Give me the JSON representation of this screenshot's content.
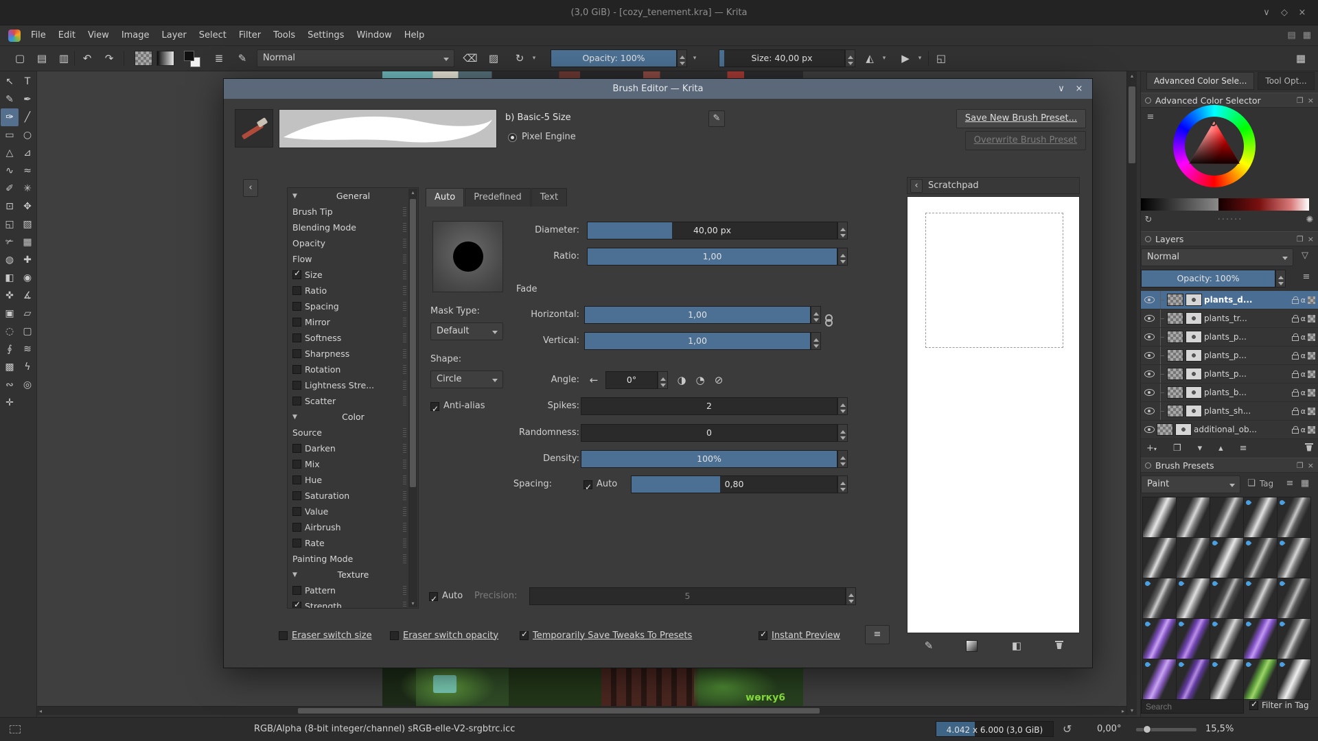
{
  "window": {
    "title": "(3,0 GiB) - [cozy_tenement.kra] — Krita"
  },
  "icons": {
    "shade": "∨",
    "restore": "◇",
    "close": "×",
    "new_doc": "▢",
    "open_doc": "▤",
    "save_doc": "▥",
    "undo": "↶",
    "redo": "↷",
    "choose_preset": "≣",
    "brush_editor": "✎",
    "eraser": "⌫",
    "preserve_alpha": "▨",
    "reload": "↻",
    "caret": "▾",
    "mirror_h": "◭",
    "mirror_v": "▶",
    "crop": "◱",
    "workspace": "▦",
    "panel_a": "▤",
    "panel_b": "▦",
    "chevron_left": "‹",
    "edit": "✎",
    "section_open": "▼",
    "angle_flip": "←",
    "angle_grad": "◑",
    "angle_half": "◔",
    "angle_compass": "⊘",
    "hamburger": "≡",
    "alpha": "α",
    "float": "❐",
    "close_small": "×",
    "list": "≡",
    "settings": "✺",
    "refresh": "↻",
    "funnel": "▽",
    "dots": "······",
    "add": "+",
    "duplicate": "❐",
    "down": "▾",
    "up": "▴",
    "properties": "≡",
    "pencil": "✎",
    "fill": "◧",
    "tag": "❏",
    "list_view": "≡",
    "grid_view": "▦",
    "rotate_reset": "↺",
    "scroll_up": "▴",
    "scroll_down": "▾",
    "scroll_left": "◂",
    "scroll_right": "▸"
  },
  "menubar": {
    "items": [
      "File",
      "Edit",
      "View",
      "Image",
      "Layer",
      "Select",
      "Filter",
      "Tools",
      "Settings",
      "Window",
      "Help"
    ]
  },
  "toolbar": {
    "blending_mode": "Normal",
    "opacity": {
      "label": "Opacity: 100%",
      "fill": "100%"
    },
    "size": {
      "label": "Size: 40,00 px",
      "fill": "4%"
    }
  },
  "toolbox": {
    "tools": [
      {
        "name": "select-shapes",
        "glyph": "↖"
      },
      {
        "name": "text",
        "glyph": "T"
      },
      {
        "name": "edit-shapes",
        "glyph": "✎"
      },
      {
        "name": "calligraphy",
        "glyph": "✒"
      },
      {
        "name": "freehand-brush",
        "glyph": "✑",
        "selected": true
      },
      {
        "name": "line",
        "glyph": "╱"
      },
      {
        "name": "rectangle",
        "glyph": "▭"
      },
      {
        "name": "ellipse",
        "glyph": "○"
      },
      {
        "name": "polygon",
        "glyph": "△"
      },
      {
        "name": "polyline",
        "glyph": "⊿"
      },
      {
        "name": "bezier-curve",
        "glyph": "∿"
      },
      {
        "name": "freehand-path",
        "glyph": "≈"
      },
      {
        "name": "dynamic-brush",
        "glyph": "✐"
      },
      {
        "name": "multibrush",
        "glyph": "✳"
      },
      {
        "name": "transform",
        "glyph": "⊡"
      },
      {
        "name": "move",
        "glyph": "✥"
      },
      {
        "name": "crop",
        "glyph": "◱"
      },
      {
        "name": "gradient",
        "glyph": "▧"
      },
      {
        "name": "color-sampler",
        "glyph": "✃"
      },
      {
        "name": "pattern-edit",
        "glyph": "▦"
      },
      {
        "name": "colorize-mask",
        "glyph": "◍"
      },
      {
        "name": "smart-patch",
        "glyph": "✚"
      },
      {
        "name": "fill",
        "glyph": "◧"
      },
      {
        "name": "enclose-fill",
        "glyph": "◉"
      },
      {
        "name": "assistants",
        "glyph": "✜"
      },
      {
        "name": "measure",
        "glyph": "∡"
      },
      {
        "name": "reference-images",
        "glyph": "▣"
      },
      {
        "name": "rect-select",
        "glyph": "▱"
      },
      {
        "name": "ellipse-select",
        "glyph": "◌"
      },
      {
        "name": "polygon-select",
        "glyph": "▢"
      },
      {
        "name": "freehand-select",
        "glyph": "∮"
      },
      {
        "name": "similar-select",
        "glyph": "≋"
      },
      {
        "name": "contiguous-select",
        "glyph": "▩"
      },
      {
        "name": "magnetic-select",
        "glyph": "ϟ"
      },
      {
        "name": "bezier-select",
        "glyph": "∾"
      },
      {
        "name": "zoom",
        "glyph": "◎"
      },
      {
        "name": "pan",
        "glyph": "✛"
      }
    ]
  },
  "canvas": {
    "watermark": "wөrку6"
  },
  "dialog": {
    "title": "Brush Editor — Krita",
    "preset_name": "b) Basic-5 Size",
    "engine_name": "Pixel Engine",
    "save_button": "Save New Brush Preset...",
    "overwrite_button": "Overwrite Brush Preset",
    "tabs": [
      {
        "label": "Auto",
        "active": true
      },
      {
        "label": "Predefined",
        "active": false
      },
      {
        "label": "Text",
        "active": false
      }
    ],
    "options": [
      {
        "type": "header",
        "label": "General"
      },
      {
        "type": "plain",
        "label": "Brush Tip"
      },
      {
        "type": "plain",
        "label": "Blending Mode"
      },
      {
        "type": "plain",
        "label": "Opacity"
      },
      {
        "type": "plain",
        "label": "Flow"
      },
      {
        "type": "check",
        "label": "Size",
        "checked": true
      },
      {
        "type": "check",
        "label": "Ratio",
        "checked": false
      },
      {
        "type": "check",
        "label": "Spacing",
        "checked": false
      },
      {
        "type": "check",
        "label": "Mirror",
        "checked": false
      },
      {
        "type": "check",
        "label": "Softness",
        "checked": false
      },
      {
        "type": "check",
        "label": "Sharpness",
        "checked": false
      },
      {
        "type": "check",
        "label": "Rotation",
        "checked": false
      },
      {
        "type": "check",
        "label": "Lightness Stre...",
        "checked": false
      },
      {
        "type": "check",
        "label": "Scatter",
        "checked": false
      },
      {
        "type": "header",
        "label": "Color"
      },
      {
        "type": "plain",
        "label": "Source"
      },
      {
        "type": "check",
        "label": "Darken",
        "checked": false
      },
      {
        "type": "check",
        "label": "Mix",
        "checked": false
      },
      {
        "type": "check",
        "label": "Hue",
        "checked": false
      },
      {
        "type": "check",
        "label": "Saturation",
        "checked": false
      },
      {
        "type": "check",
        "label": "Value",
        "checked": false
      },
      {
        "type": "check",
        "label": "Airbrush",
        "checked": false
      },
      {
        "type": "check",
        "label": "Rate",
        "checked": false
      },
      {
        "type": "plain",
        "label": "Painting Mode"
      },
      {
        "type": "header",
        "label": "Texture"
      },
      {
        "type": "check",
        "label": "Pattern",
        "checked": false
      },
      {
        "type": "check",
        "label": "Strength",
        "checked": true
      }
    ],
    "settings": {
      "diameter": {
        "label": "Diameter:",
        "value": "40,00 px",
        "fill": "34%"
      },
      "ratio": {
        "label": "Ratio:",
        "value": "1,00",
        "fill": "100%"
      },
      "fade_label": "Fade",
      "mask_type_label": "Mask Type:",
      "mask_type": "Default",
      "horizontal": {
        "label": "Horizontal:",
        "value": "1,00",
        "fill": "100%"
      },
      "vertical": {
        "label": "Vertical:",
        "value": "1,00",
        "fill": "100%"
      },
      "shape_label": "Shape:",
      "shape": "Circle",
      "angle": {
        "label": "Angle:",
        "value": "0°"
      },
      "antialias": {
        "label": "Anti-alias",
        "checked": true
      },
      "spikes": {
        "label": "Spikes:",
        "value": "2",
        "fill": "0%"
      },
      "randomness": {
        "label": "Randomness:",
        "value": "0",
        "fill": "0%"
      },
      "density": {
        "label": "Density:",
        "value": "100%",
        "fill": "100%"
      },
      "spacing": {
        "label": "Spacing:",
        "auto_label": "Auto",
        "auto_checked": true,
        "value": "0,80",
        "fill": "43%"
      },
      "auto_row": {
        "label": "Auto",
        "checked": true
      },
      "precision": {
        "label": "Precision:",
        "value": "5",
        "fill": "0%"
      }
    },
    "footer": {
      "eraser_switch_size": {
        "label": "Eraser switch size",
        "checked": false
      },
      "eraser_switch_opacity": {
        "label": "Eraser switch opacity",
        "checked": false
      },
      "save_tweaks": {
        "label": "Temporarily Save Tweaks To Presets",
        "checked": true
      },
      "instant_preview": {
        "label": "Instant Preview",
        "checked": true
      }
    },
    "scratchpad_title": "Scratchpad"
  },
  "right_panel": {
    "tabs": [
      {
        "label": "Advanced Color Sele...",
        "active": true
      },
      {
        "label": "Tool Opt...",
        "active": false
      }
    ],
    "color_selector": {
      "title": "Advanced Color Selector"
    },
    "layers": {
      "title": "Layers",
      "blending_mode": "Normal",
      "opacity": {
        "label": "Opacity: 100%",
        "fill": "100%"
      },
      "rows": [
        {
          "name": "plants_d...",
          "selected": true,
          "tree": true
        },
        {
          "name": "plants_tr...",
          "selected": false,
          "tree": true
        },
        {
          "name": "plants_p...",
          "selected": false,
          "tree": true
        },
        {
          "name": "plants_p...",
          "selected": false,
          "tree": true
        },
        {
          "name": "plants_p...",
          "selected": false,
          "tree": true
        },
        {
          "name": "plants_b...",
          "selected": false,
          "tree": true
        },
        {
          "name": "plants_sh...",
          "selected": false,
          "tree": true
        },
        {
          "name": "additional_ob...",
          "selected": false,
          "tree": false
        }
      ]
    },
    "brush_presets": {
      "title": "Brush Presets",
      "tag_filter": "Paint",
      "tag_label": "Tag",
      "search_placeholder": "Search",
      "filter_label": "Filter in Tag",
      "filter_checked": true,
      "presets": [
        {
          "a": "#e6e6e6",
          "b": "#9a9a9a",
          "drop": false
        },
        {
          "a": "#d8d8d8",
          "b": "#808080",
          "drop": false
        },
        {
          "a": "#cfcfcf",
          "b": "#6f6f6f",
          "drop": false
        },
        {
          "a": "#e2e2e2",
          "b": "#8a8a8a",
          "drop": true
        },
        {
          "a": "#c9c9c9",
          "b": "#5f5f5f",
          "drop": true
        },
        {
          "a": "#dedede",
          "b": "#747474",
          "drop": false
        },
        {
          "a": "#d2d2d2",
          "b": "#666666",
          "drop": false
        },
        {
          "a": "#e8e8e8",
          "b": "#999999",
          "drop": true
        },
        {
          "a": "#c4c4c4",
          "b": "#585858",
          "drop": true
        },
        {
          "a": "#d6d6d6",
          "b": "#7a7a7a",
          "drop": true
        },
        {
          "a": "#cccccc",
          "b": "#646464",
          "drop": true
        },
        {
          "a": "#e0e0e0",
          "b": "#8f8f8f",
          "drop": true
        },
        {
          "a": "#b9b9b9",
          "b": "#515151",
          "drop": true
        },
        {
          "a": "#d4d4d4",
          "b": "#707070",
          "drop": true
        },
        {
          "a": "#c0c0c0",
          "b": "#5a5a5a",
          "drop": true
        },
        {
          "a": "#c9a2f0",
          "b": "#7d4fc0",
          "drop": true
        },
        {
          "a": "#bb8ee6",
          "b": "#6f43b2",
          "drop": true
        },
        {
          "a": "#d9d9d9",
          "b": "#838383",
          "drop": true
        },
        {
          "a": "#c39bef",
          "b": "#8050c5",
          "drop": true
        },
        {
          "a": "#cfcfcf",
          "b": "#6a6a6a",
          "drop": true
        },
        {
          "a": "#c9a7ee",
          "b": "#8d5fc8",
          "drop": true
        },
        {
          "a": "#b48ae0",
          "b": "#5f3a9e",
          "drop": true
        },
        {
          "a": "#e4e4e4",
          "b": "#9c9c9c",
          "drop": true
        },
        {
          "a": "#9fd46a",
          "b": "#5a9c3a",
          "drop": true
        },
        {
          "a": "#efefef",
          "b": "#aaaaaa",
          "drop": true
        }
      ]
    }
  },
  "statusbar": {
    "colorspace": "RGB/Alpha (8-bit integer/channel)  sRGB-elle-V2-srgbtrc.icc",
    "memory": {
      "label": "4.042 x 6.000 (3,0 GiB)",
      "fill": "33%"
    },
    "angle": "0,00°",
    "zoom": "15,5%"
  },
  "colors": {
    "accent": "#4b7093",
    "selection": "#4a6d94",
    "dialog_titlebar": "#5a6879"
  }
}
